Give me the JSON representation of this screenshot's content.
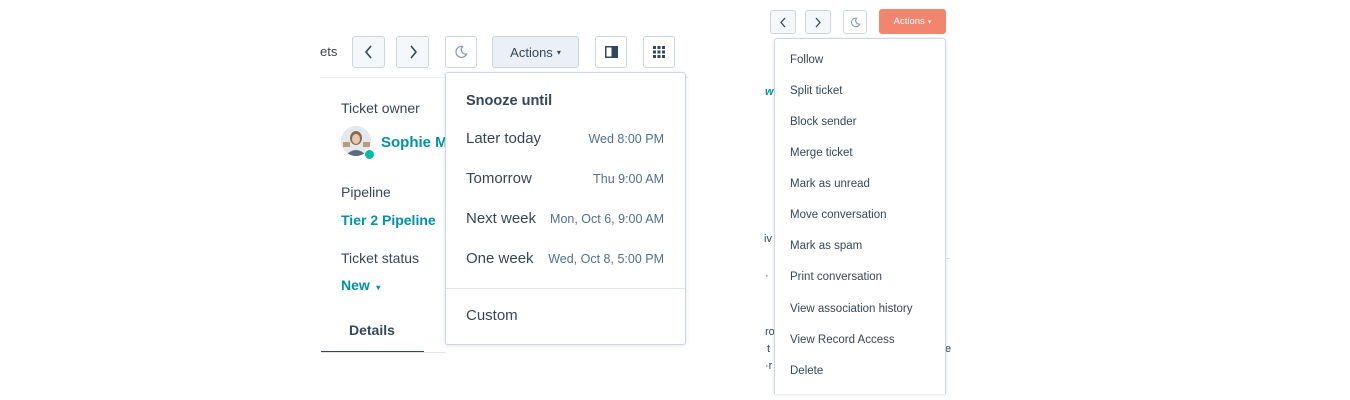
{
  "left": {
    "toolbar": {
      "crumb_fragment": "ets",
      "actions_label": "Actions",
      "actions_caret": "▾"
    },
    "sidebar": {
      "owner_label": "Ticket owner",
      "owner_name": "Sophie M",
      "pipeline_label": "Pipeline",
      "pipeline_value": "Tier 2 Pipeline",
      "status_label": "Ticket status",
      "status_value": "New",
      "status_caret": "▾",
      "tab_details": "Details"
    },
    "snooze": {
      "title": "Snooze until",
      "options": [
        {
          "label": "Later today",
          "time": "Wed 8:00 PM"
        },
        {
          "label": "Tomorrow",
          "time": "Thu 9:00 AM"
        },
        {
          "label": "Next week",
          "time": "Mon, Oct 6, 9:00 AM"
        },
        {
          "label": "One week",
          "time": "Wed, Oct 8, 5:00 PM"
        }
      ],
      "custom": "Custom"
    }
  },
  "right": {
    "toolbar": {
      "actions_label": "Actions",
      "actions_caret": "▾",
      "actions_color": "#f2856e"
    },
    "bg_fragments": [
      "w",
      "iv",
      "·",
      "ro",
      "t",
      "·r",
      "e"
    ],
    "menu_items": [
      "Follow",
      "Split ticket",
      "Block sender",
      "Merge ticket",
      "Mark as unread",
      "Move conversation",
      "Mark as spam",
      "Print conversation",
      "View association history",
      "View Record Access",
      "Delete"
    ]
  },
  "colors": {
    "link": "#0091ae",
    "text": "#33475b",
    "status_online": "#00bda5",
    "border": "#cbd6e2"
  }
}
